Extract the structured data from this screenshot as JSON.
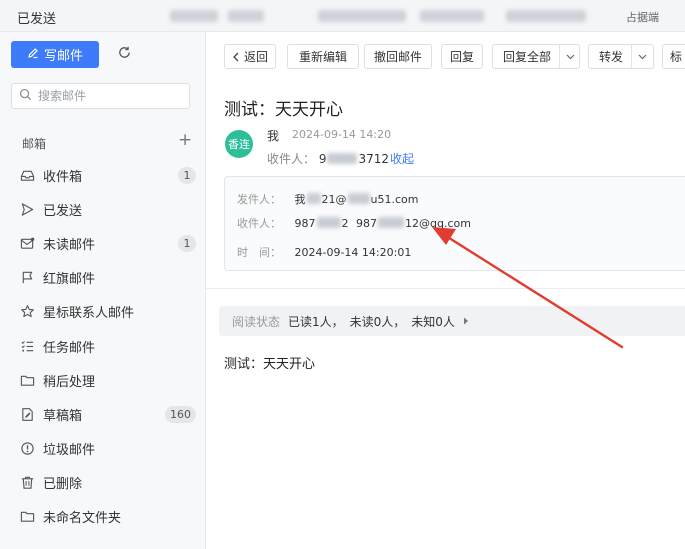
{
  "window": {
    "title": "已发送",
    "right_text": "占据端"
  },
  "sidebar": {
    "compose_label": "写邮件",
    "search_placeholder": "搜索邮件",
    "section_label": "邮箱",
    "add_folder": "+",
    "folders": [
      {
        "label": "收件箱",
        "icon": "inbox-icon",
        "badge": "1"
      },
      {
        "label": "已发送",
        "icon": "send-icon",
        "badge": ""
      },
      {
        "label": "未读邮件",
        "icon": "unread-mail-icon",
        "badge": "1"
      },
      {
        "label": "红旗邮件",
        "icon": "flag-icon",
        "badge": ""
      },
      {
        "label": "星标联系人邮件",
        "icon": "star-icon",
        "badge": ""
      },
      {
        "label": "任务邮件",
        "icon": "task-list-icon",
        "badge": ""
      },
      {
        "label": "稍后处理",
        "icon": "folder-icon",
        "badge": ""
      },
      {
        "label": "草稿箱",
        "icon": "draft-icon",
        "badge": "160"
      },
      {
        "label": "垃圾邮件",
        "icon": "spam-icon",
        "badge": ""
      },
      {
        "label": "已删除",
        "icon": "trash-icon",
        "badge": ""
      },
      {
        "label": "未命名文件夹",
        "icon": "folder-icon",
        "badge": ""
      }
    ]
  },
  "toolbar": {
    "back": "返回",
    "reedit": "重新编辑",
    "recall": "撤回邮件",
    "reply": "回复",
    "reply_all": "回复全部",
    "forward": "转发",
    "mark": "标"
  },
  "mail": {
    "subject": "测试：天天开心",
    "avatar_text": "香连",
    "sender_name": "我",
    "sent_time": "2024-09-14 14:20",
    "to_label": "收件人：",
    "to_value_a": "9",
    "to_value_b": "3712",
    "collapse_label": "收起",
    "details": {
      "from_label": "发件人：",
      "from_a": "我",
      "from_b": "21@",
      "from_c": "u51.com",
      "to_label": "收件人：",
      "to_a": "987",
      "to_b": "2",
      "to_c": "987",
      "to_d": "12@qq.com",
      "time_label": "时　间：",
      "time_value": "2024-09-14 14:20:01"
    },
    "read_status": {
      "label": "阅读状态",
      "read": "已读1人，",
      "unread": "未读0人，",
      "unknown": "未知0人"
    },
    "body": "测试：天天开心"
  },
  "colors": {
    "accent": "#3e7bfa",
    "avatar": "#2dbf9a",
    "annotation_arrow": "#e03c2f"
  }
}
